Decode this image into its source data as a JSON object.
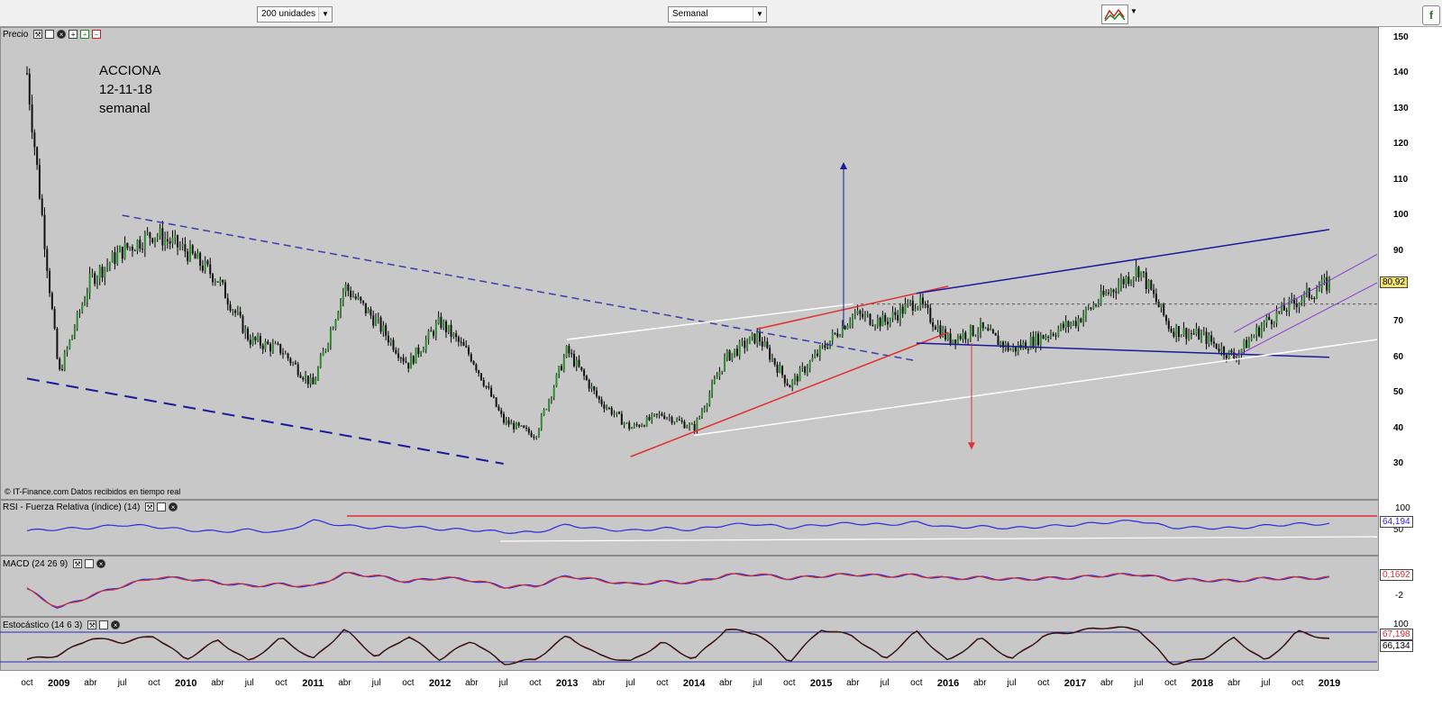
{
  "toolbar": {
    "units_select": "200 unidades",
    "period_select": "Semanal",
    "logo_glyph": "f"
  },
  "annotation": {
    "line1": "ACCIONA",
    "line2": "12-11-18",
    "line3": "semanal"
  },
  "credit": "© IT-Finance.com  Datos recibidos en tiempo real",
  "panels": {
    "price_label": "Precio",
    "rsi_label": "RSI - Fuerza Relativa (índice) (14)",
    "macd_label": "MACD (24 26 9)",
    "stoch_label": "Estocástico (14 6 3)"
  },
  "chart_data": [
    {
      "type": "ohlc",
      "title": "ACCIONA",
      "annotation": "12-11-18 semanal",
      "ylim": [
        25,
        155
      ],
      "y_ticks": [
        30,
        40,
        50,
        60,
        70,
        80,
        90,
        100,
        110,
        120,
        130,
        140,
        150
      ],
      "last_value": "80,92",
      "dates": [
        "2008-10",
        "2009-01",
        "2009-04",
        "2009-07",
        "2009-10",
        "2010-01",
        "2010-04",
        "2010-07",
        "2010-10",
        "2011-01",
        "2011-04",
        "2011-07",
        "2011-10",
        "2012-01",
        "2012-04",
        "2012-07",
        "2012-10",
        "2013-01",
        "2013-04",
        "2013-07",
        "2013-10",
        "2014-01",
        "2014-04",
        "2014-07",
        "2014-10",
        "2015-01",
        "2015-04",
        "2015-07",
        "2015-10",
        "2016-01",
        "2016-04",
        "2016-07",
        "2016-10",
        "2017-01",
        "2017-04",
        "2017-07",
        "2017-10",
        "2018-01",
        "2018-04",
        "2018-07",
        "2018-10",
        "2018-11"
      ],
      "close": [
        140,
        55,
        82,
        90,
        95,
        90,
        82,
        65,
        62,
        52,
        80,
        70,
        58,
        70,
        60,
        42,
        38,
        62,
        48,
        40,
        44,
        40,
        60,
        66,
        52,
        62,
        72,
        70,
        76,
        65,
        68,
        62,
        66,
        70,
        78,
        85,
        68,
        66,
        60,
        70,
        76,
        81
      ],
      "trendlines": [
        {
          "from": [
            "2009-07",
            100
          ],
          "to": [
            "2015-10",
            59
          ],
          "style": "dashed",
          "color": "#3b3bb0"
        },
        {
          "from": [
            "2008-10",
            54
          ],
          "to": [
            "2012-07",
            30
          ],
          "style": "dashed",
          "color": "#1a1a9a"
        },
        {
          "from": [
            "2013-07",
            32
          ],
          "to": [
            "2016-01",
            67
          ],
          "style": "solid",
          "color": "#e03030"
        },
        {
          "from": [
            "2014-07",
            68
          ],
          "to": [
            "2016-01",
            80
          ],
          "style": "solid",
          "color": "#e03030"
        },
        {
          "from": [
            "2015-10",
            78
          ],
          "to": [
            "2018-11",
            96
          ],
          "style": "solid",
          "color": "#1a1a9a"
        },
        {
          "from": [
            "2015-10",
            64
          ],
          "to": [
            "2018-11",
            60
          ],
          "style": "solid",
          "color": "#1a1a9a"
        }
      ],
      "targets": {
        "up_arrow_top": 115,
        "down_arrow_bottom": 34
      }
    },
    {
      "type": "line",
      "title": "RSI - Fuerza Relativa (índice) (14)",
      "ylim": [
        0,
        100
      ],
      "y_ticks": [
        50,
        100
      ],
      "last_value": "64,194",
      "values": [
        48,
        52,
        55,
        62,
        58,
        50,
        46,
        50,
        44,
        72,
        60,
        55,
        58,
        52,
        50,
        45,
        44,
        62,
        52,
        48,
        54,
        50,
        62,
        64,
        55,
        62,
        66,
        62,
        68,
        56,
        58,
        54,
        58,
        62,
        68,
        72,
        56,
        55,
        54,
        60,
        64,
        64
      ]
    },
    {
      "type": "line",
      "title": "MACD (24 26 9)",
      "ylim": [
        -4,
        2
      ],
      "y_ticks": [
        -2
      ],
      "last_value": "0,1692",
      "values": [
        -1.2,
        -3.5,
        -2.0,
        -0.8,
        0.2,
        0.1,
        -0.4,
        -0.8,
        -0.6,
        -0.9,
        0.7,
        0.4,
        -0.3,
        0.2,
        -0.1,
        -0.9,
        -0.8,
        0.4,
        -0.1,
        -0.6,
        -0.3,
        -0.4,
        0.5,
        0.6,
        0.1,
        0.4,
        0.6,
        0.4,
        0.5,
        0.1,
        0.2,
        0.0,
        0.1,
        0.2,
        0.5,
        0.6,
        0.0,
        -0.1,
        -0.2,
        0.1,
        0.15,
        0.17
      ]
    },
    {
      "type": "line",
      "title": "Estocástico (14 6 3)",
      "ylim": [
        0,
        100
      ],
      "y_ticks": [
        100
      ],
      "last_values": [
        "67,198",
        "66,134"
      ],
      "values": [
        20,
        30,
        70,
        60,
        75,
        20,
        65,
        15,
        70,
        20,
        90,
        25,
        75,
        20,
        65,
        10,
        20,
        75,
        30,
        15,
        60,
        20,
        90,
        80,
        15,
        90,
        75,
        20,
        85,
        15,
        70,
        20,
        75,
        85,
        95,
        90,
        10,
        20,
        70,
        15,
        85,
        67
      ]
    }
  ],
  "x_axis": {
    "labels": [
      "oct",
      "2009",
      "abr",
      "jul",
      "oct",
      "2010",
      "abr",
      "jul",
      "oct",
      "2011",
      "abr",
      "jul",
      "oct",
      "2012",
      "abr",
      "jul",
      "oct",
      "2013",
      "abr",
      "jul",
      "oct",
      "2014",
      "abr",
      "jul",
      "oct",
      "2015",
      "abr",
      "jul",
      "oct",
      "2016",
      "abr",
      "jul",
      "oct",
      "2017",
      "abr",
      "jul",
      "oct",
      "2018",
      "abr",
      "jul",
      "oct",
      "2019"
    ]
  }
}
